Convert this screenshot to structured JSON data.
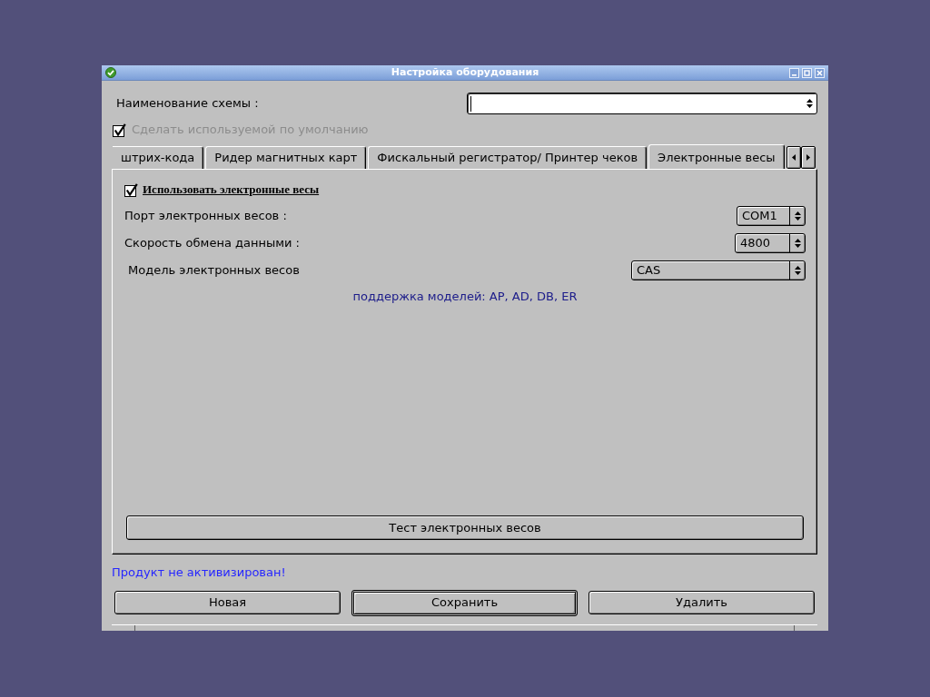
{
  "window": {
    "title": "Настройка оборудования"
  },
  "scheme_name": {
    "label": "Наименование схемы :",
    "focused": true
  },
  "default_checkbox": {
    "label": "Сделать используемой по умолчанию",
    "checked": true,
    "disabled": true
  },
  "tabs": [
    {
      "label": "штрих-кода",
      "selected": false
    },
    {
      "label": "Ридер магнитных карт",
      "selected": false
    },
    {
      "label": "Фискальный регистратор/ Принтер чеков",
      "selected": false
    },
    {
      "label": "Электронные весы",
      "selected": true
    }
  ],
  "scales": {
    "enable": {
      "label": "Использовать электронные весы",
      "checked": true
    },
    "fields": [
      {
        "label": "Порт электронных весов :",
        "value": "COM1"
      },
      {
        "label": "Скорость обмена данными :",
        "value": "4800"
      },
      {
        "label": "Модель электронных весов",
        "value": "CAS"
      }
    ],
    "note": "поддержка моделей: AP, AD, DB, ER",
    "test_button": "Тест электронных весов"
  },
  "status": "Продукт не активизирован!",
  "buttons": [
    {
      "label": "Новая",
      "default": false
    },
    {
      "label": "Сохранить",
      "default": true
    },
    {
      "label": "Удалить",
      "default": false
    }
  ]
}
